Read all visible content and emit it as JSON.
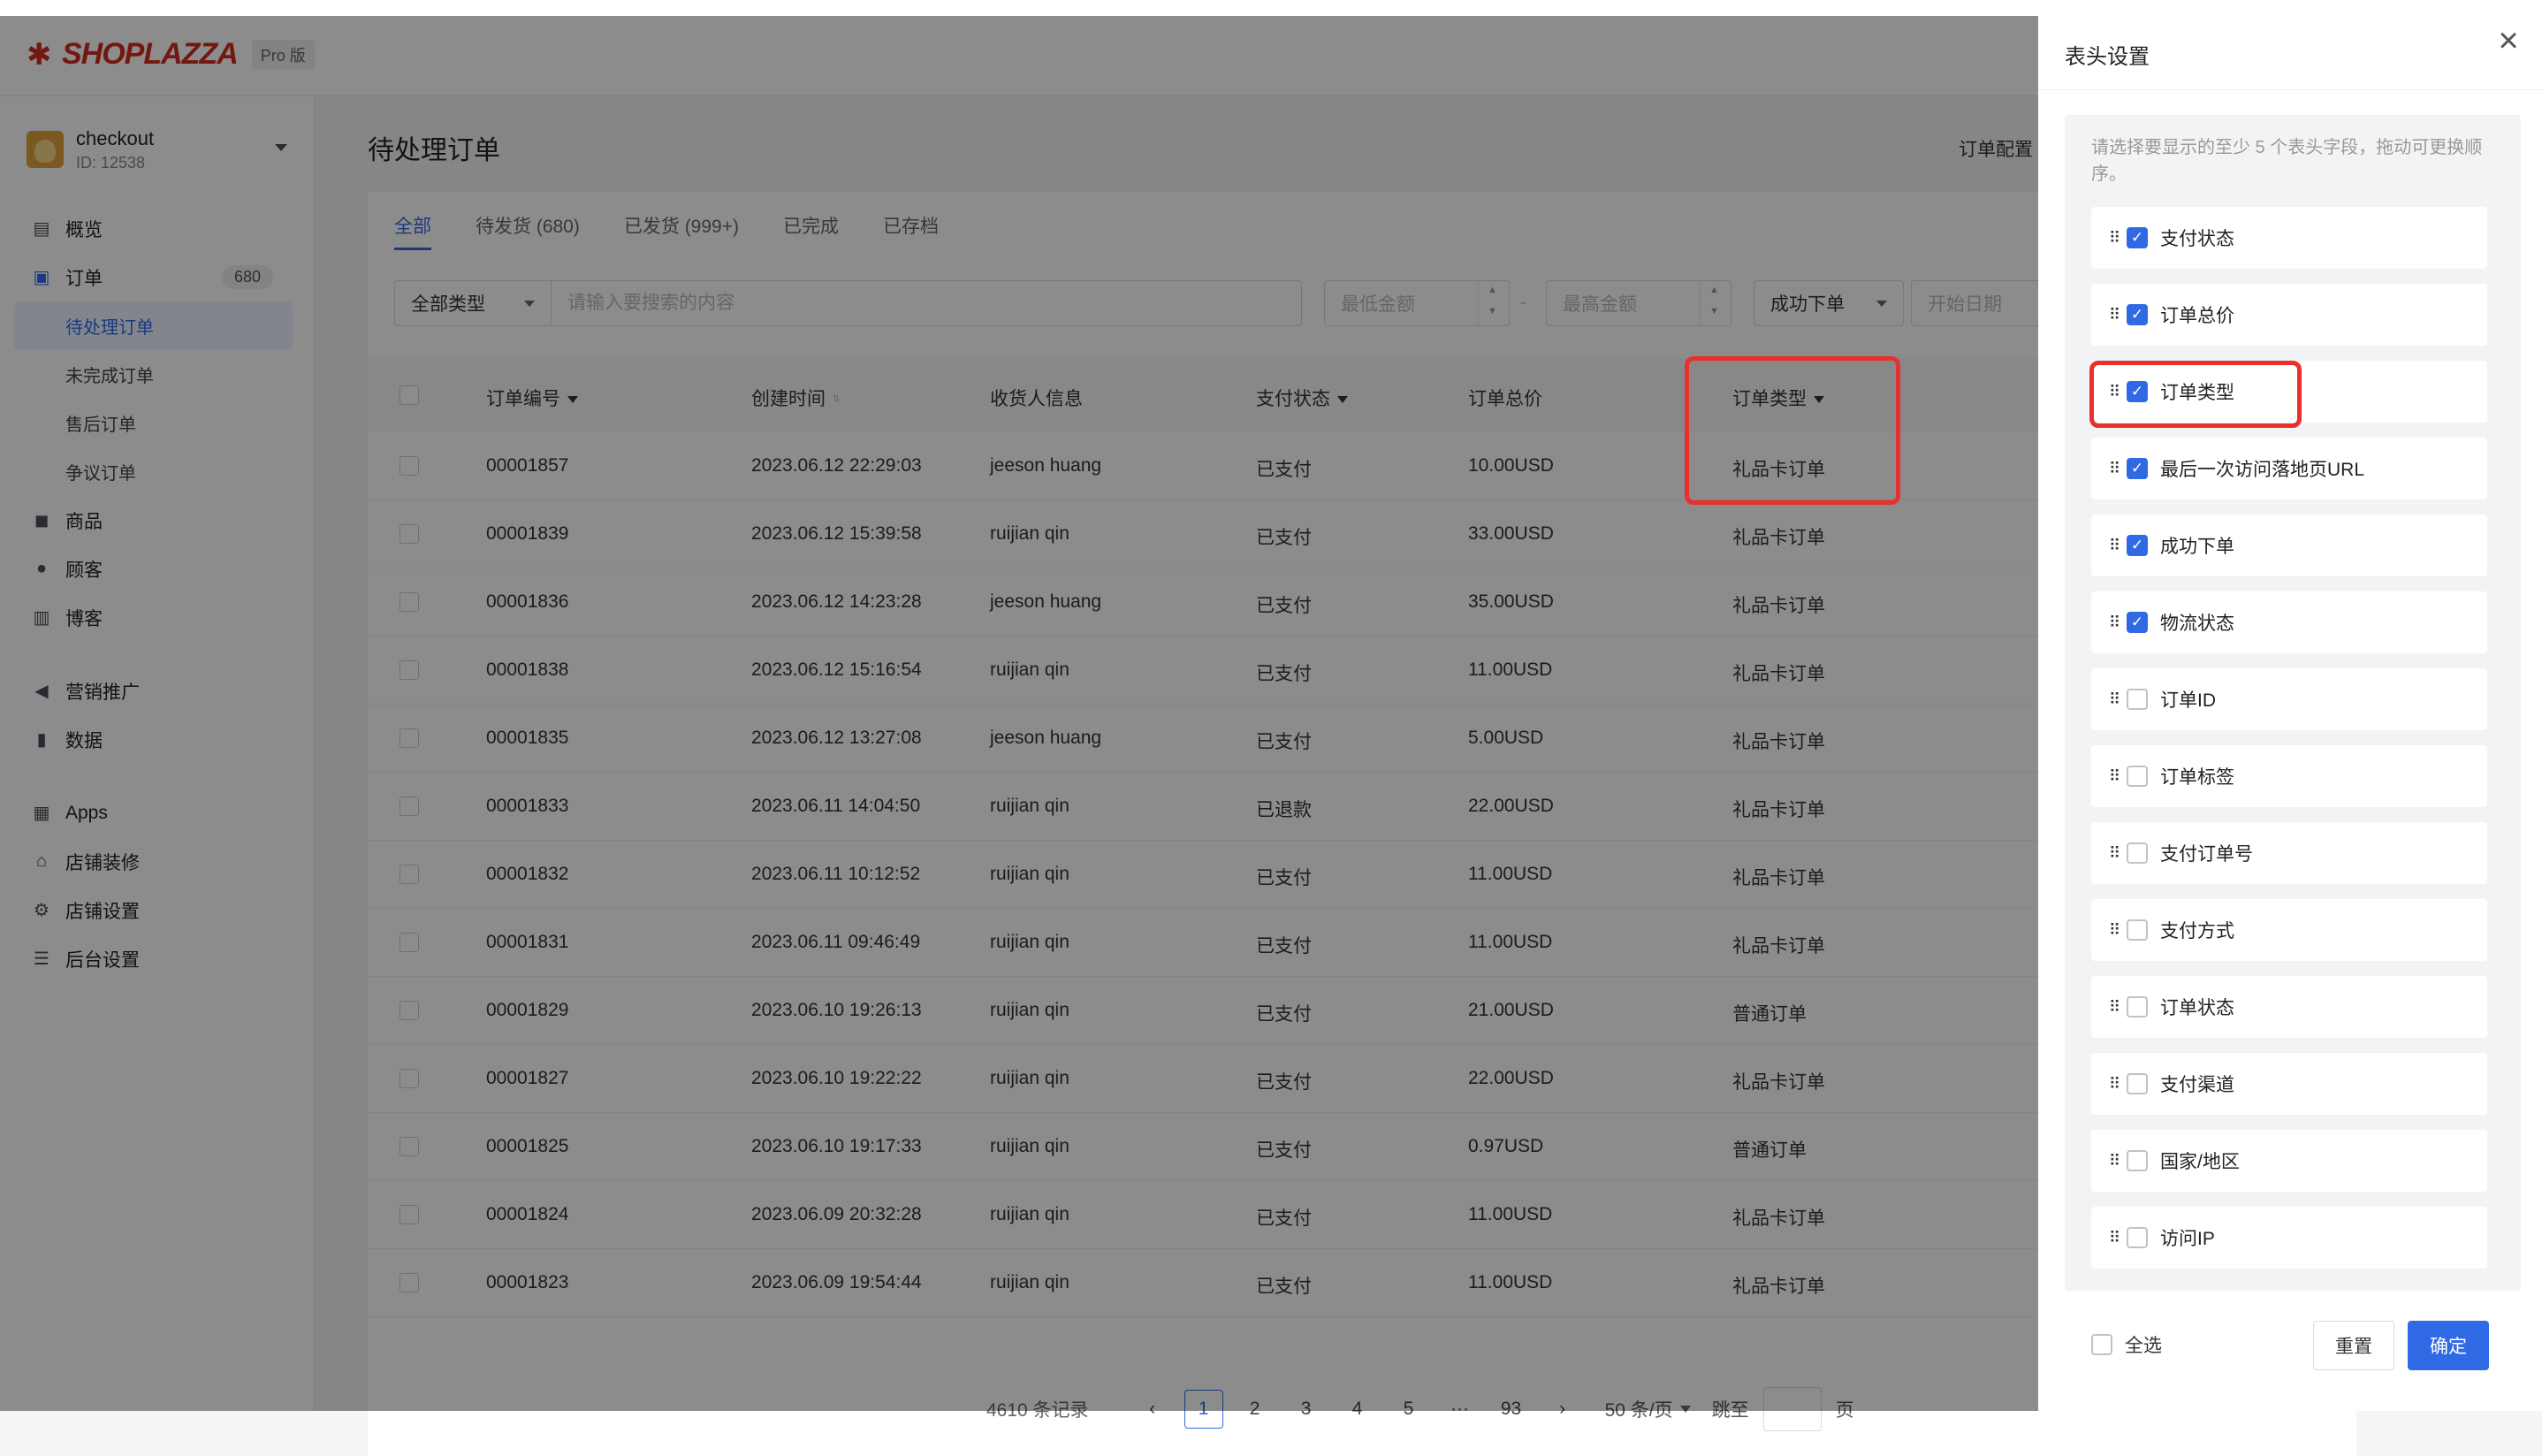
{
  "header": {
    "brand": "SHOPLAZZA",
    "badge": "Pro 版"
  },
  "store": {
    "name": "checkout",
    "id": "ID: 12538"
  },
  "nav": {
    "overview": "概览",
    "orders": "订单",
    "orders_count": "680",
    "pending_orders": "待处理订单",
    "incomplete_orders": "未完成订单",
    "after_sale_orders": "售后订单",
    "dispute_orders": "争议订单",
    "products": "商品",
    "customers": "顾客",
    "blog": "博客",
    "marketing": "营销推广",
    "data": "数据",
    "apps": "Apps",
    "store_design": "店铺装修",
    "store_settings": "店铺设置",
    "admin_settings": "后台设置"
  },
  "page": {
    "title": "待处理订单",
    "order_config": "订单配置"
  },
  "tabs": [
    "全部",
    "待发货 (680)",
    "已发货 (999+)",
    "已完成",
    "已存档"
  ],
  "filters": {
    "type_select": "全部类型",
    "search_placeholder": "请输入要搜索的内容",
    "min_amount": "最低金额",
    "range_sep": "-",
    "max_amount": "最高金额",
    "status_select": "成功下单",
    "start_date": "开始日期"
  },
  "table": {
    "headers": {
      "order_no": "订单编号",
      "created": "创建时间",
      "recipient": "收货人信息",
      "pay_status": "支付状态",
      "total": "订单总价",
      "order_type": "订单类型"
    },
    "rows": [
      {
        "no": "00001857",
        "time": "2023.06.12 22:29:03",
        "name": "jeeson huang",
        "pay": "已支付",
        "total": "10.00USD",
        "type": "礼品卡订单"
      },
      {
        "no": "00001839",
        "time": "2023.06.12 15:39:58",
        "name": "ruijian qin",
        "pay": "已支付",
        "total": "33.00USD",
        "type": "礼品卡订单"
      },
      {
        "no": "00001836",
        "time": "2023.06.12 14:23:28",
        "name": "jeeson huang",
        "pay": "已支付",
        "total": "35.00USD",
        "type": "礼品卡订单"
      },
      {
        "no": "00001838",
        "time": "2023.06.12 15:16:54",
        "name": "ruijian qin",
        "pay": "已支付",
        "total": "11.00USD",
        "type": "礼品卡订单"
      },
      {
        "no": "00001835",
        "time": "2023.06.12 13:27:08",
        "name": "jeeson huang",
        "pay": "已支付",
        "total": "5.00USD",
        "type": "礼品卡订单"
      },
      {
        "no": "00001833",
        "time": "2023.06.11 14:04:50",
        "name": "ruijian qin",
        "pay": "已退款",
        "total": "22.00USD",
        "type": "礼品卡订单"
      },
      {
        "no": "00001832",
        "time": "2023.06.11 10:12:52",
        "name": "ruijian qin",
        "pay": "已支付",
        "total": "11.00USD",
        "type": "礼品卡订单"
      },
      {
        "no": "00001831",
        "time": "2023.06.11 09:46:49",
        "name": "ruijian qin",
        "pay": "已支付",
        "total": "11.00USD",
        "type": "礼品卡订单"
      },
      {
        "no": "00001829",
        "time": "2023.06.10 19:26:13",
        "name": "ruijian qin",
        "pay": "已支付",
        "total": "21.00USD",
        "type": "普通订单"
      },
      {
        "no": "00001827",
        "time": "2023.06.10 19:22:22",
        "name": "ruijian qin",
        "pay": "已支付",
        "total": "22.00USD",
        "type": "礼品卡订单"
      },
      {
        "no": "00001825",
        "time": "2023.06.10 19:17:33",
        "name": "ruijian qin",
        "pay": "已支付",
        "total": "0.97USD",
        "type": "普通订单"
      },
      {
        "no": "00001824",
        "time": "2023.06.09 20:32:28",
        "name": "ruijian qin",
        "pay": "已支付",
        "total": "11.00USD",
        "type": "礼品卡订单"
      },
      {
        "no": "00001823",
        "time": "2023.06.09 19:54:44",
        "name": "ruijian qin",
        "pay": "已支付",
        "total": "11.00USD",
        "type": "礼品卡订单"
      }
    ]
  },
  "pagination": {
    "total": "4610 条记录",
    "pages": [
      "1",
      "2",
      "3",
      "4",
      "5"
    ],
    "ellipsis": "···",
    "last": "93",
    "per_page": "50 条/页",
    "jump_label": "跳至",
    "page_label": "页"
  },
  "drawer": {
    "title": "表头设置",
    "tip": "请选择要显示的至少 5 个表头字段，拖动可更换顺序。",
    "fields": [
      {
        "label": "支付状态",
        "checked": true
      },
      {
        "label": "订单总价",
        "checked": true
      },
      {
        "label": "订单类型",
        "checked": true
      },
      {
        "label": "最后一次访问落地页URL",
        "checked": true
      },
      {
        "label": "成功下单",
        "checked": true
      },
      {
        "label": "物流状态",
        "checked": true
      },
      {
        "label": "订单ID",
        "checked": false
      },
      {
        "label": "订单标签",
        "checked": false
      },
      {
        "label": "支付订单号",
        "checked": false
      },
      {
        "label": "支付方式",
        "checked": false
      },
      {
        "label": "订单状态",
        "checked": false
      },
      {
        "label": "支付渠道",
        "checked": false
      },
      {
        "label": "国家/地区",
        "checked": false
      },
      {
        "label": "访问IP",
        "checked": false
      }
    ],
    "select_all": "全选",
    "reset": "重置",
    "confirm": "确定"
  },
  "colors": {
    "accent": "#2f6ae4",
    "brand": "#d42b1e",
    "highlight": "#e8312c"
  }
}
